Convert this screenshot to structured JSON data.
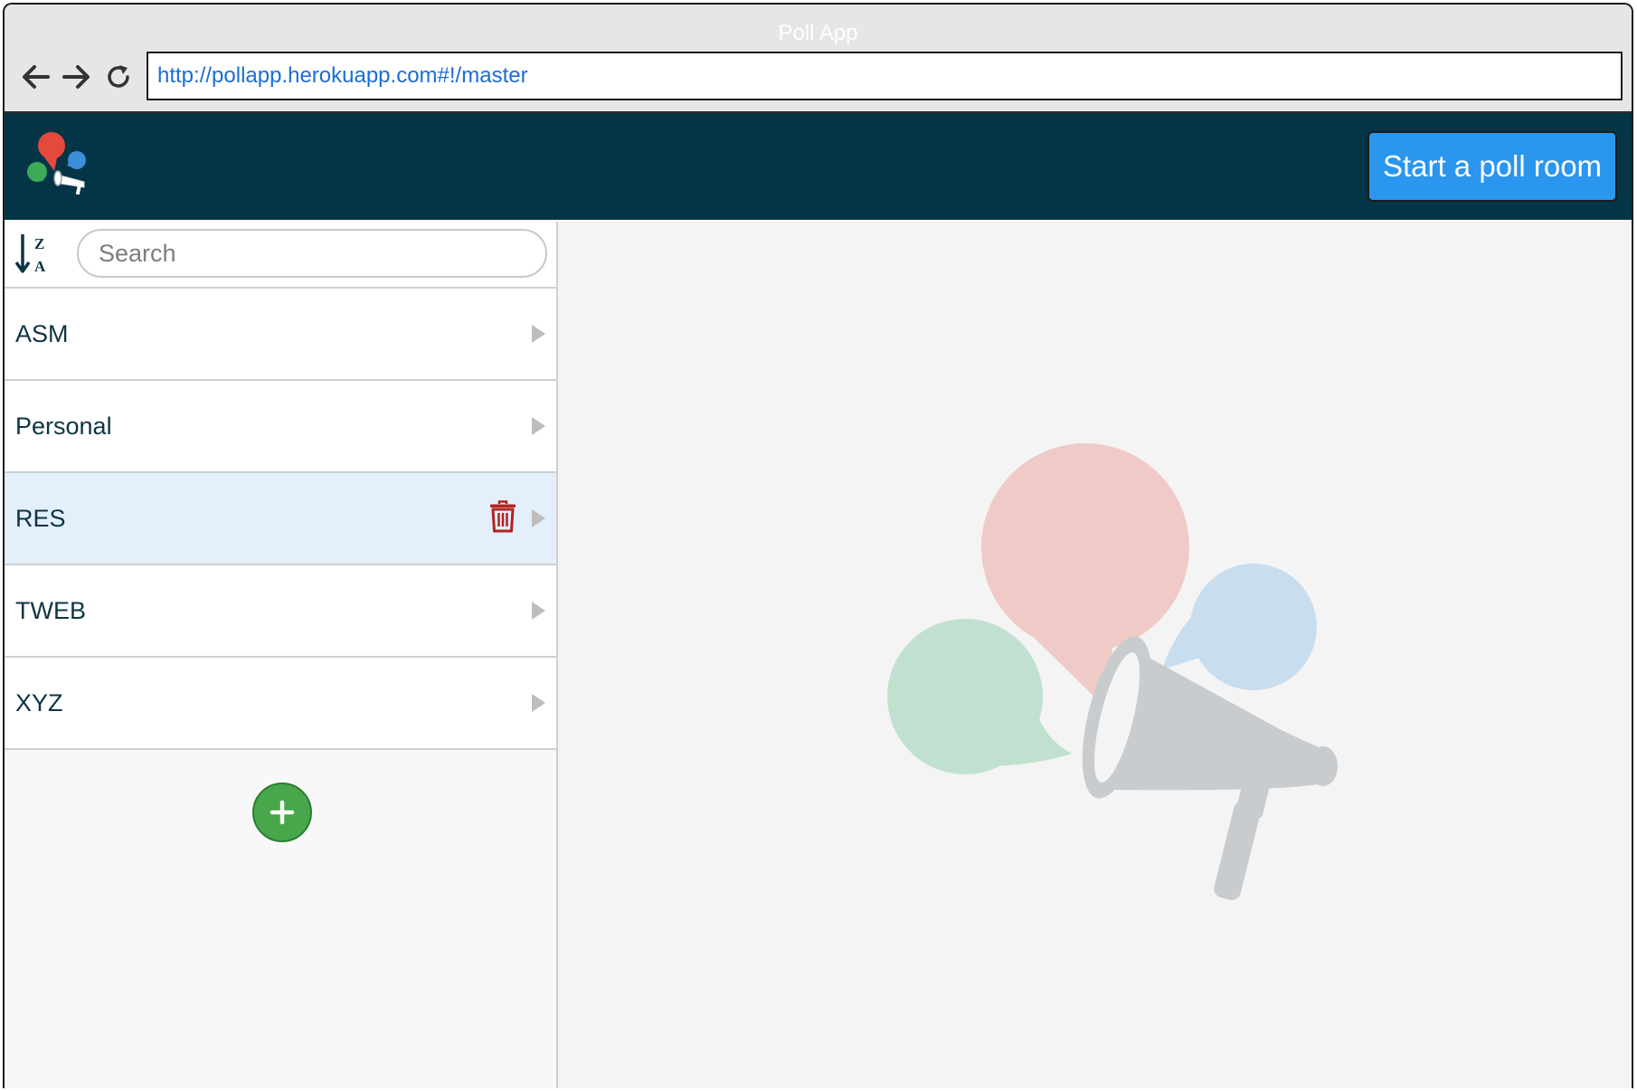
{
  "browser": {
    "window_title": "Poll App",
    "url": "http://pollapp.herokuapp.com#!/master",
    "icons": [
      "back-arrow-icon",
      "forward-arrow-icon",
      "reload-icon"
    ]
  },
  "header": {
    "logo_icon": "poll-app-logo",
    "start_button_label": "Start a poll room",
    "background_color": "#033546",
    "button_color": "#2a96ee"
  },
  "sidebar": {
    "sort_icon": "sort-alpha-desc-icon",
    "search": {
      "placeholder": "Search",
      "value": ""
    },
    "items": [
      {
        "label": "ASM",
        "selected": false
      },
      {
        "label": "Personal",
        "selected": false
      },
      {
        "label": "RES",
        "selected": true,
        "action_icon": "trash-icon"
      },
      {
        "label": "TWEB",
        "selected": false
      },
      {
        "label": "XYZ",
        "selected": false
      }
    ],
    "add_icon": "plus-icon",
    "add_button_color": "#47a74a",
    "selected_color": "#e3f0fb",
    "trash_color": "#b22222"
  },
  "main": {
    "illustration": "megaphone-speech-bubbles-icon",
    "colors": {
      "red": "#f0cac6",
      "green": "#c0e1cf",
      "blue": "#c8ddee",
      "megaphone": "#c9ccce"
    }
  }
}
